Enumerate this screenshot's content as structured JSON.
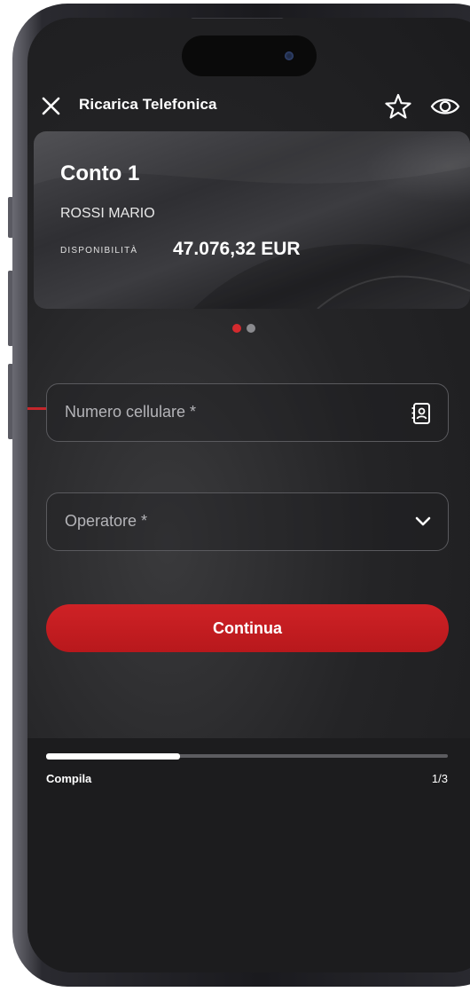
{
  "header": {
    "title": "Ricarica Telefonica",
    "close_icon": "close-icon",
    "favorite_icon": "star-outline-icon",
    "visibility_icon": "eye-icon"
  },
  "account": {
    "name": "Conto 1",
    "holder": "ROSSI MARIO",
    "availability_label": "DISPONIBILITÀ",
    "availability_value": "47.076,32 EUR"
  },
  "pager": {
    "total": 2,
    "active_index": 0,
    "active_color": "#d42a2e",
    "inactive_color": "#8a8a8e"
  },
  "form": {
    "phone_placeholder": "Numero cellulare *",
    "contacts_icon": "contacts-icon",
    "operator_placeholder": "Operatore *",
    "operator_icon": "chevron-down-icon",
    "continue_label": "Continua"
  },
  "progress": {
    "step_label": "Compila",
    "step_count": "1/3",
    "fraction": 0.333
  },
  "colors": {
    "accent": "#c4262b",
    "background": "#232325"
  }
}
